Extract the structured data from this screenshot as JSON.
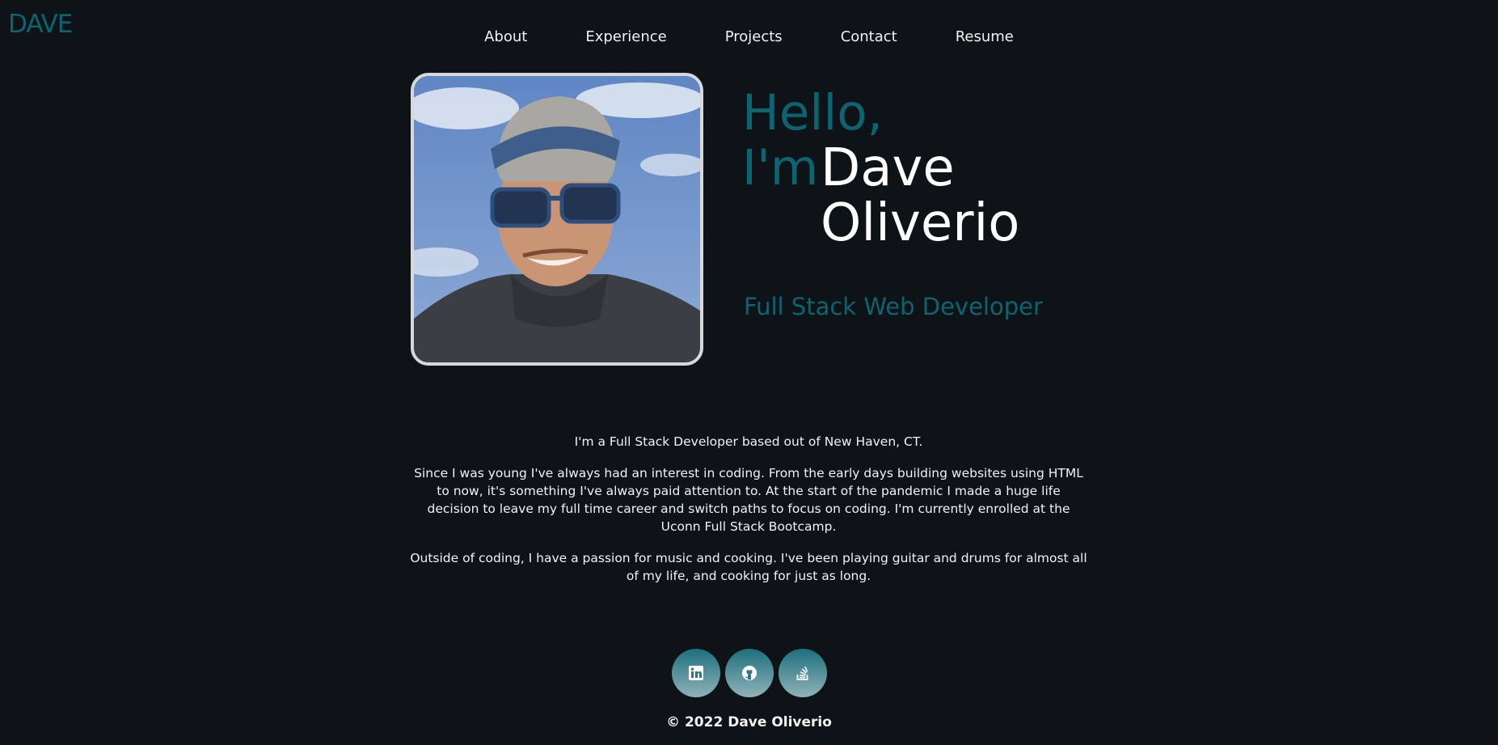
{
  "brand": {
    "logo": "DAVE"
  },
  "nav": {
    "items": [
      {
        "label": "About"
      },
      {
        "label": "Experience"
      },
      {
        "label": "Projects"
      },
      {
        "label": "Contact"
      },
      {
        "label": "Resume"
      }
    ]
  },
  "hero": {
    "hello": "Hello,",
    "im": "I'm",
    "first_name": "Dave",
    "last_name": "Oliverio",
    "title": "Full Stack Web Developer"
  },
  "about": {
    "paragraphs": [
      "I'm a Full Stack Developer based out of New Haven, CT.",
      "Since I was young I've always had an interest in coding. From the early days building websites using HTML to now, it's something I've always paid attention to. At the start of the pandemic I made a huge life decision to leave my full time career and switch paths to focus on coding. I'm currently enrolled at the Uconn Full Stack Bootcamp.",
      "Outside of coding, I have a passion for music and cooking. I've been playing guitar and drums for almost all of my life, and cooking for just as long."
    ]
  },
  "socials": [
    {
      "icon": "linkedin-icon"
    },
    {
      "icon": "github-icon"
    },
    {
      "icon": "stackoverflow-icon"
    }
  ],
  "footer": {
    "copyright": "© 2022 Dave Oliverio"
  },
  "colors": {
    "background": "#0d1317",
    "accent": "#0b6470",
    "text": "#f2f2f2",
    "social_gradient_top": "#1d6f7c",
    "social_gradient_bottom": "#8fb3b8"
  }
}
